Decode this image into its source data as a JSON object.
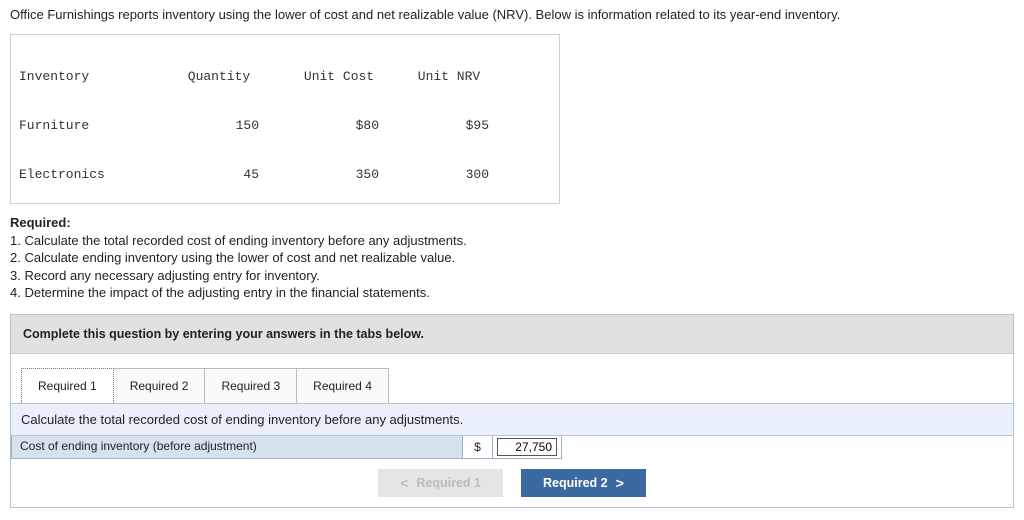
{
  "intro": "Office Furnishings reports inventory using the lower of cost and net realizable value (NRV). Below is information related to its year-end inventory.",
  "table": {
    "headers": {
      "c1": "Inventory",
      "c2": "Quantity",
      "c3": "Unit Cost",
      "c4": "Unit NRV"
    },
    "rows": [
      {
        "c1": "Furniture",
        "c2": "150",
        "c3": "$80",
        "c4": "$95"
      },
      {
        "c1": "Electronics",
        "c2": "45",
        "c3": "350",
        "c4": "300"
      }
    ]
  },
  "required": {
    "label": "Required:",
    "items": [
      "1. Calculate the total recorded cost of ending inventory before any adjustments.",
      "2. Calculate ending inventory using the lower of cost and net realizable value.",
      "3. Record any necessary adjusting entry for inventory.",
      "4. Determine the impact of the adjusting entry in the financial statements."
    ]
  },
  "worksheet": {
    "header": "Complete this question by entering your answers in the tabs below.",
    "tabs": [
      "Required 1",
      "Required 2",
      "Required 3",
      "Required 4"
    ],
    "activeTab": 0,
    "instruction": "Calculate the total recorded cost of ending inventory before any adjustments.",
    "answer": {
      "label": "Cost of ending inventory (before adjustment)",
      "currency": "$",
      "value": "27,750"
    },
    "nav": {
      "prev": "Required 1",
      "prevChevron": "<",
      "next": "Required 2",
      "nextChevron": ">"
    }
  },
  "chart_data": {
    "type": "table",
    "title": "Year-end inventory data",
    "columns": [
      "Inventory",
      "Quantity",
      "Unit Cost",
      "Unit NRV"
    ],
    "rows": [
      [
        "Furniture",
        150,
        80,
        95
      ],
      [
        "Electronics",
        45,
        350,
        300
      ]
    ]
  }
}
